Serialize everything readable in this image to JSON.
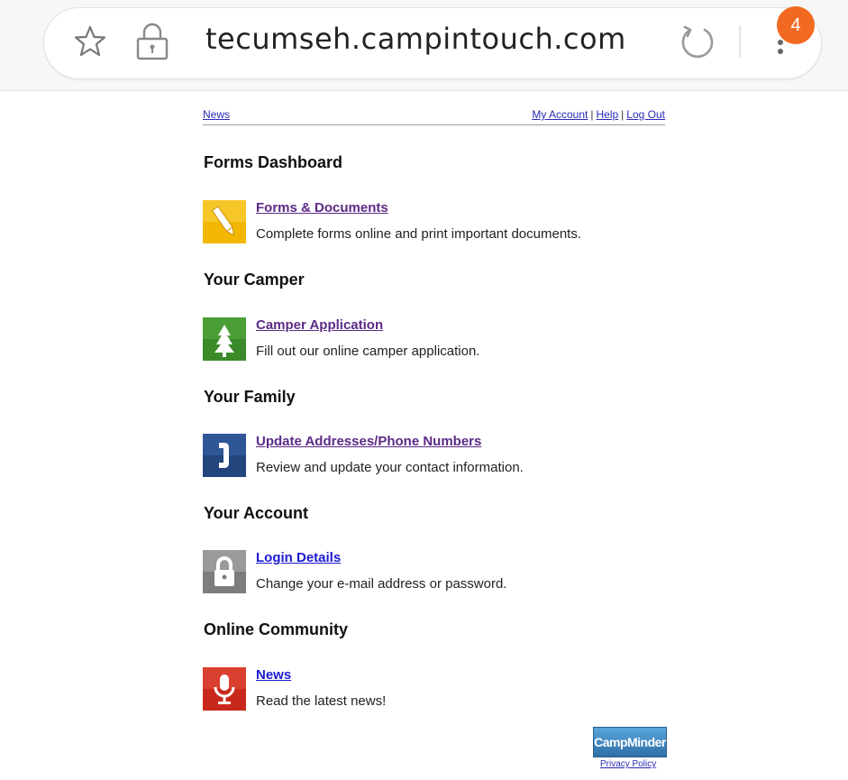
{
  "browser": {
    "url": "tecumseh.campintouch.com",
    "tab_count": "4",
    "icons": [
      "star-icon",
      "lock-icon",
      "reload-icon",
      "menu-icon"
    ]
  },
  "nav": {
    "left_link": "News",
    "right_links": [
      "My Account",
      "Help",
      "Log Out"
    ],
    "separator": "|"
  },
  "sections": [
    {
      "title": "Forms Dashboard",
      "link": "Forms & Documents",
      "desc": "Complete forms online and print important documents.",
      "icon": "pencil-icon",
      "color": "#f2b705"
    },
    {
      "title": "Your Camper",
      "link": "Camper Application",
      "desc": "Fill out our online camper application.",
      "icon": "tree-icon",
      "color": "#3a8a2a"
    },
    {
      "title": "Your Family",
      "link": "Update Addresses/Phone Numbers",
      "desc": "Review and update your contact information.",
      "icon": "phone-icon",
      "color": "#22457e"
    },
    {
      "title": "Your Account",
      "link": "Login Details",
      "desc": "Change your e-mail address or password.",
      "icon": "padlock-icon",
      "color": "#7d7d7d"
    },
    {
      "title": "Online Community",
      "link": "News",
      "desc": "Read the latest news!",
      "icon": "microphone-icon",
      "color": "#c8281c"
    }
  ],
  "footer": {
    "logo": "CampMinder",
    "privacy": "Privacy Policy"
  },
  "colors": {
    "visited_link": "#5b2a86",
    "link": "#1a1ad0",
    "badge": "#f26a21"
  }
}
